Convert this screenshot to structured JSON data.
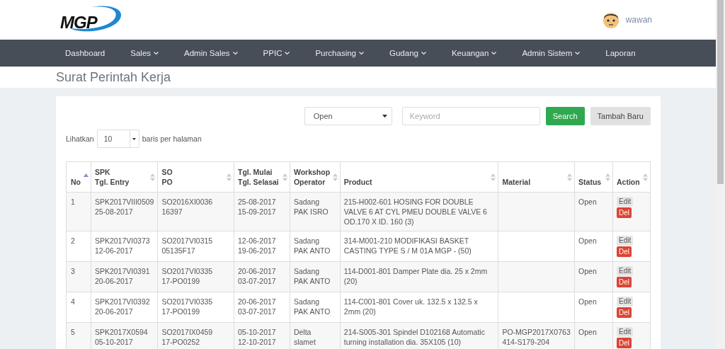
{
  "header": {
    "logo_text": "MGP",
    "user": "wawan"
  },
  "nav": [
    {
      "label": "Dashboard",
      "dropdown": false
    },
    {
      "label": "Sales",
      "dropdown": true
    },
    {
      "label": "Admin Sales",
      "dropdown": true
    },
    {
      "label": "PPIC",
      "dropdown": true
    },
    {
      "label": "Purchasing",
      "dropdown": true
    },
    {
      "label": "Gudang",
      "dropdown": true
    },
    {
      "label": "Keuangan",
      "dropdown": true
    },
    {
      "label": "Admin Sistem",
      "dropdown": true
    },
    {
      "label": "Laporan",
      "dropdown": false
    }
  ],
  "page_title": "Surat Perintah Kerja",
  "filter": {
    "status_select": "Open",
    "search": {
      "placeholder": "Keyword"
    },
    "search_button": "Search",
    "add_button": "Tambah Baru"
  },
  "page_size": {
    "label_before": "Lihatkan",
    "value": "10",
    "label_after": "baris per halaman"
  },
  "table": {
    "columns": [
      {
        "label": "No",
        "sorted": true
      },
      {
        "label": "SPK\nTgl. Entry",
        "sorted": false
      },
      {
        "label": "SO\nPO",
        "sorted": false
      },
      {
        "label": "Tgl. Mulai\nTgl. Selasai",
        "sorted": false
      },
      {
        "label": "Workshop\nOperator",
        "sorted": false
      },
      {
        "label": "Product",
        "sorted": false
      },
      {
        "label": "Material",
        "sorted": false
      },
      {
        "label": "Status",
        "sorted": false
      },
      {
        "label": "Action",
        "sorted": false
      }
    ],
    "rows": [
      {
        "no": "1",
        "spk": "SPK2017VIII0509\n25-08-2017",
        "so": "SO2016XI0036\n16397",
        "dates": "25-08-2017\n15-09-2017",
        "workshop": "Sadang\nPAK ISRO",
        "product": "215-H002-601 HOSING FOR DOUBLE VALVE 6 AT CYL PMEU DOUBLE VALVE 6 OD.170 X ID. 160 (3)",
        "material": "",
        "status": "Open",
        "actions": [
          "Edit",
          "Del"
        ]
      },
      {
        "no": "2",
        "spk": "SPK2017VI0373\n12-06-2017",
        "so": "SO2017VI0315\n05135F17",
        "dates": "12-06-2017\n19-06-2017",
        "workshop": "Sadang\nPAK ANTO",
        "product": "314-M001-210 MODIFIKASI BASKET CASTING TYPE S / M 01A MGP - (50)",
        "material": "",
        "status": "Open",
        "actions": [
          "Edit",
          "Del"
        ]
      },
      {
        "no": "3",
        "spk": "SPK2017VI0391\n20-06-2017",
        "so": "SO2017VI0335\n17-PO0199",
        "dates": "20-06-2017\n03-07-2017",
        "workshop": "Sadang\nPAK ANTO",
        "product": "114-D001-801 Damper Plate dia. 25 x 2mm (20)",
        "material": "",
        "status": "Open",
        "actions": [
          "Edit",
          "Del"
        ]
      },
      {
        "no": "4",
        "spk": "SPK2017VI0392\n20-06-2017",
        "so": "SO2017VI0335\n17-PO0199",
        "dates": "20-06-2017\n03-07-2017",
        "workshop": "Sadang\nPAK ANTO",
        "product": "114-C001-801 Cover uk. 132.5 x 132.5 x 2mm (20)",
        "material": "",
        "status": "Open",
        "actions": [
          "Edit",
          "Del"
        ]
      },
      {
        "no": "5",
        "spk": "SPK2017X0594\n05-10-2017",
        "so": "SO2017IX0459\n17-PO0252",
        "dates": "05-10-2017\n12-10-2017",
        "workshop": "Delta\nslamet",
        "product": "214-S005-301 Spindel D102168 Automatic turning installation dia. 35X105 (10)",
        "material": "PO-MGP2017X0763\n414-S179-204",
        "status": "Open",
        "actions": [
          "Edit",
          "Del"
        ]
      }
    ]
  }
}
